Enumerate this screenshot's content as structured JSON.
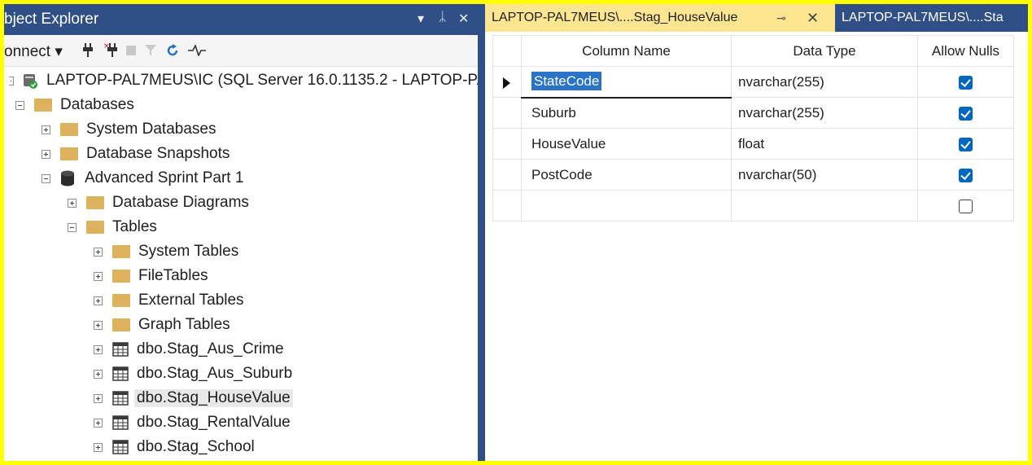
{
  "object_explorer": {
    "title": "bject Explorer",
    "title_controls": {
      "menu": "▾",
      "pin": "ᛦ",
      "close": "✕"
    },
    "toolbar": {
      "connect_label": "onnect ▾"
    },
    "tree": [
      {
        "label": "LAPTOP-PAL7MEUS\\IC (SQL Server 16.0.1135.2 - LAPTOP-PA",
        "icon": "server-icon"
      },
      {
        "label": "Databases",
        "icon": "folder-icon"
      },
      {
        "label": "System Databases",
        "icon": "folder-icon"
      },
      {
        "label": "Database Snapshots",
        "icon": "folder-icon"
      },
      {
        "label": "Advanced Sprint Part 1",
        "icon": "database-icon"
      },
      {
        "label": "Database Diagrams",
        "icon": "folder-icon"
      },
      {
        "label": "Tables",
        "icon": "folder-icon"
      },
      {
        "label": "System Tables",
        "icon": "folder-icon"
      },
      {
        "label": "FileTables",
        "icon": "folder-icon"
      },
      {
        "label": "External Tables",
        "icon": "folder-icon"
      },
      {
        "label": "Graph Tables",
        "icon": "folder-icon"
      },
      {
        "label": "dbo.Stag_Aus_Crime",
        "icon": "table-icon"
      },
      {
        "label": "dbo.Stag_Aus_Suburb",
        "icon": "table-icon"
      },
      {
        "label": "dbo.Stag_HouseValue",
        "icon": "table-icon"
      },
      {
        "label": "dbo.Stag_RentalValue",
        "icon": "table-icon"
      },
      {
        "label": "dbo.Stag_School",
        "icon": "table-icon"
      }
    ]
  },
  "designer": {
    "tabs": [
      {
        "label": "LAPTOP-PAL7MEUS\\....Stag_HouseValue",
        "pin": "⊸",
        "close": "✕"
      },
      {
        "label": "LAPTOP-PAL7MEUS\\....Sta"
      }
    ],
    "headers": {
      "column_name": "Column Name",
      "data_type": "Data Type",
      "allow_nulls": "Allow Nulls"
    },
    "rows": [
      {
        "column_name": "StateCode",
        "data_type": "nvarchar(255)",
        "allow_nulls": true
      },
      {
        "column_name": "Suburb",
        "data_type": "nvarchar(255)",
        "allow_nulls": true
      },
      {
        "column_name": "HouseValue",
        "data_type": "float",
        "allow_nulls": true
      },
      {
        "column_name": "PostCode",
        "data_type": "nvarchar(50)",
        "allow_nulls": true
      },
      {
        "column_name": "",
        "data_type": "",
        "allow_nulls": false
      }
    ]
  },
  "colors": {
    "highlight_border": "#ffff00",
    "panel_title_bg": "#2f4f86",
    "active_tab_bg": "#fde68f",
    "selection_bg": "#2a74c8",
    "checkbox_checked": "#0067c0",
    "folder": "#dcb35c"
  }
}
